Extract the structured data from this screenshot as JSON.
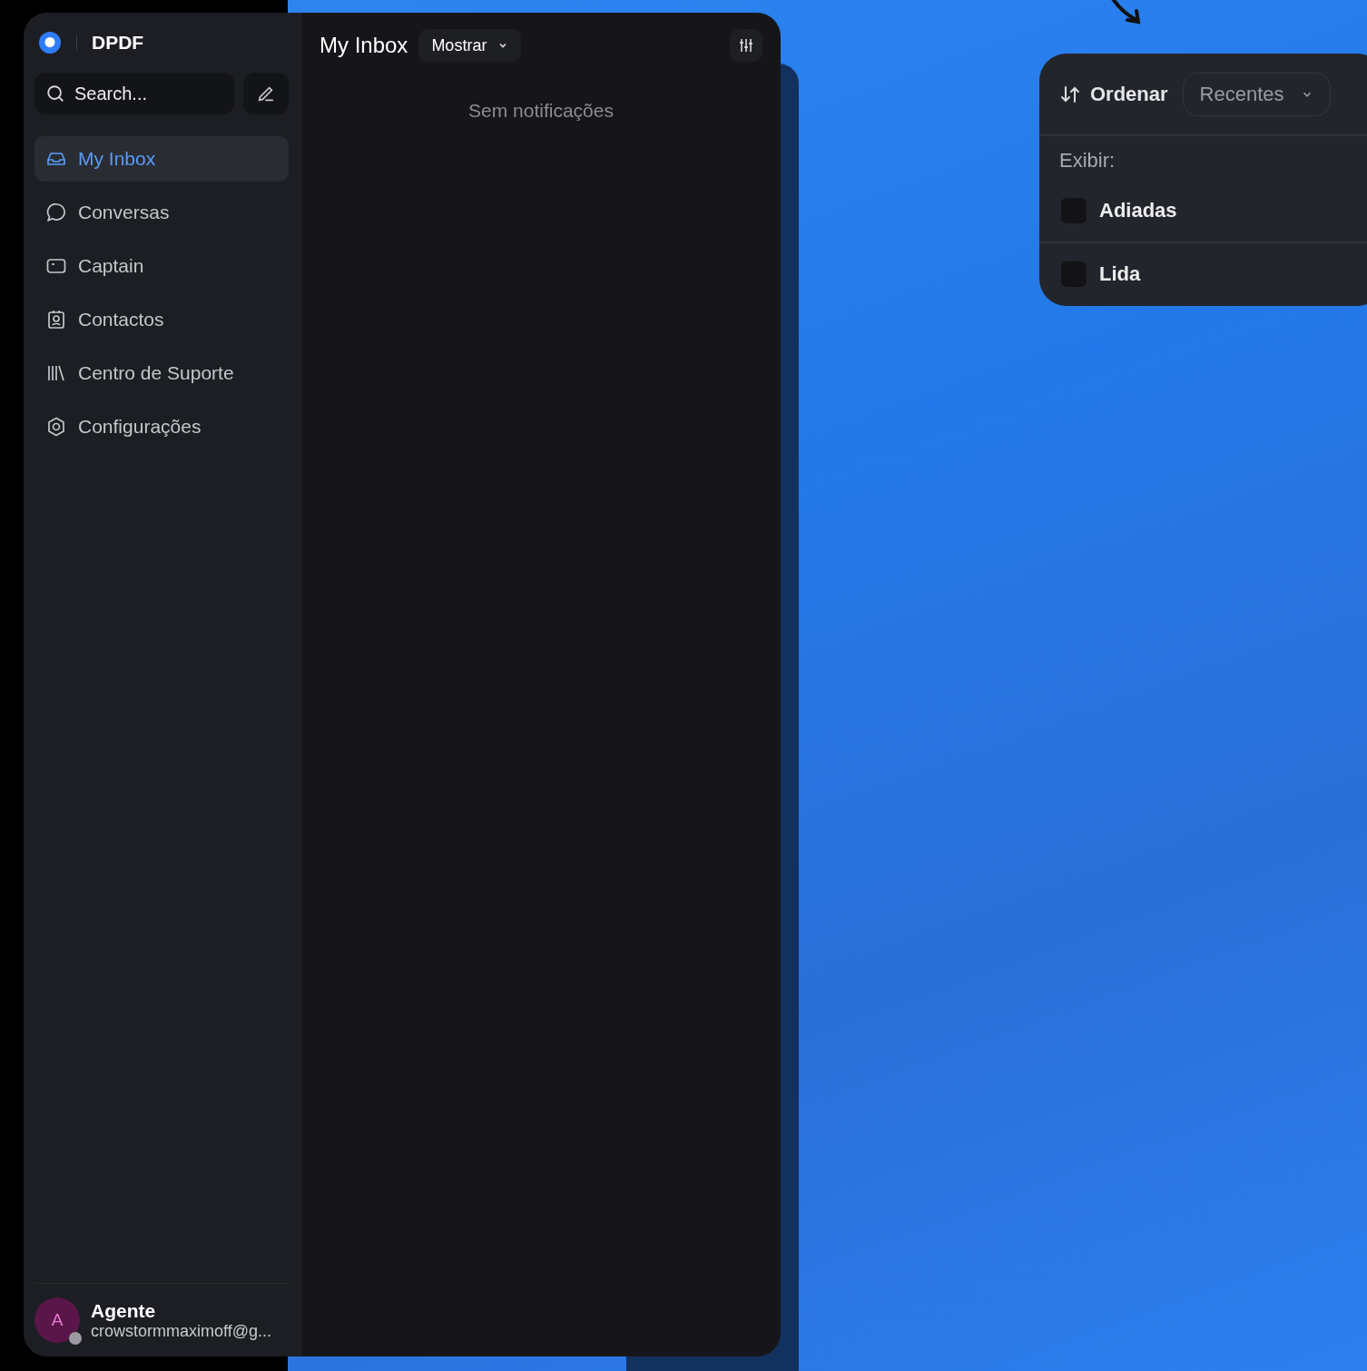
{
  "sidebar": {
    "brand": "DPDF",
    "search": {
      "placeholder": "Search..."
    },
    "items": [
      {
        "label": "My Inbox",
        "selected": true
      },
      {
        "label": "Conversas",
        "selected": false
      },
      {
        "label": "Captain",
        "selected": false
      },
      {
        "label": "Contactos",
        "selected": false
      },
      {
        "label": "Centro de Suporte",
        "selected": false
      },
      {
        "label": "Configurações",
        "selected": false
      }
    ],
    "user": {
      "initial": "A",
      "name": "Agente",
      "email": "crowstormmaximoff@g...",
      "online": false
    }
  },
  "inbox": {
    "title": "My Inbox",
    "filter": "Mostrar",
    "empty_text": "Sem notificações"
  },
  "popup": {
    "sort_label": "Ordenar",
    "sort_value": "Recentes",
    "show_label": "Exibir:",
    "options": [
      {
        "label": "Adiadas",
        "checked": false
      },
      {
        "label": "Lida",
        "checked": false
      }
    ]
  }
}
